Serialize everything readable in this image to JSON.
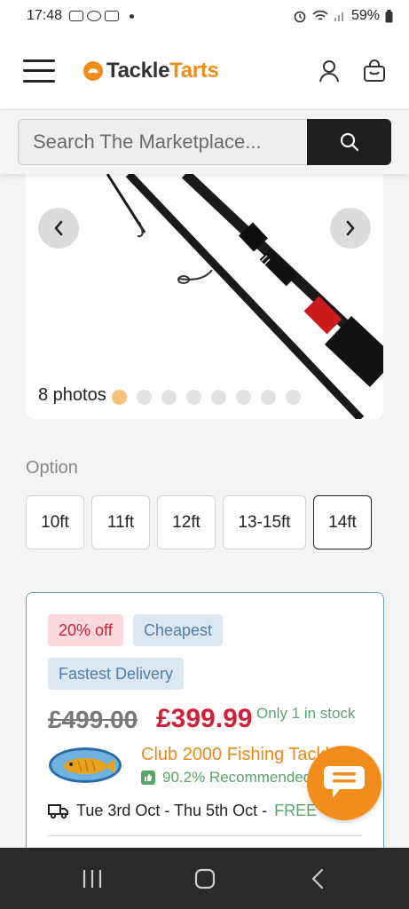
{
  "status_bar": {
    "time": "17:48",
    "battery": "59%"
  },
  "header": {
    "logo_part1": "Tackle",
    "logo_part2": "Tarts",
    "icons": [
      "menu-icon",
      "user-icon",
      "basket-icon"
    ]
  },
  "search": {
    "placeholder": "Search The Marketplace..."
  },
  "gallery": {
    "photo_count": "8 photos",
    "dots_total": 8,
    "active_dot": 0
  },
  "options": {
    "label": "Option",
    "items": [
      "10ft",
      "11ft",
      "12ft",
      "13-15ft",
      "14ft"
    ],
    "selected": "14ft"
  },
  "offer": {
    "badge_discount": "20% off",
    "badge_cheapest": "Cheapest",
    "badge_delivery": "Fastest Delivery",
    "was_price": "£499.00",
    "price": "£399.99",
    "stock": "Only 1 in stock",
    "seller_name": "Club 2000 Fishing Tackle",
    "recommended": "90.2% Recommended",
    "delivery_dates": "Tue 3rd Oct - Thu 5th Oct -",
    "delivery_cost": "FREE"
  },
  "colors": {
    "brand_orange": "#f28c1b",
    "sale_red": "#d0213a",
    "green": "#5aa469",
    "badge_blue": "#4d7fae"
  }
}
